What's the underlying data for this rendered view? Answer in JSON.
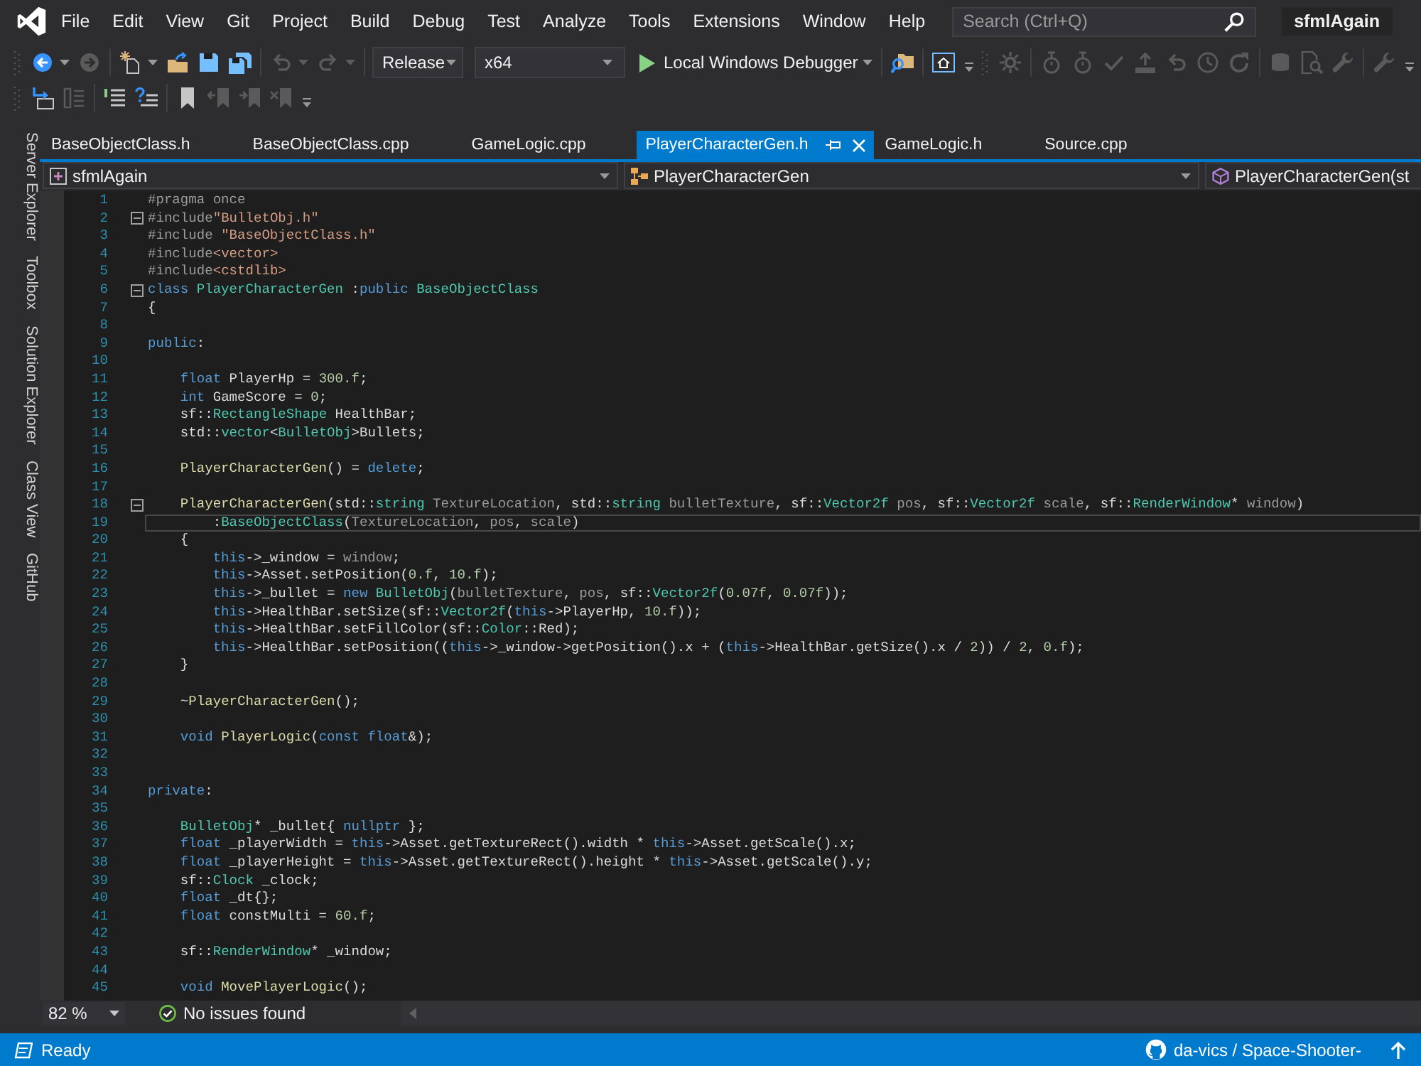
{
  "menu_bar": {
    "items": [
      "File",
      "Edit",
      "View",
      "Git",
      "Project",
      "Build",
      "Debug",
      "Test",
      "Analyze",
      "Tools",
      "Extensions",
      "Window",
      "Help"
    ],
    "search": {
      "placeholder": "Search (Ctrl+Q)"
    },
    "solution_name": "sfmlAgain"
  },
  "toolbar": {
    "rows": [
      [
        {
          "kind": "grip"
        },
        {
          "kind": "split",
          "disabled": false
        },
        {
          "kind": "button",
          "disabled": true
        },
        {
          "kind": "separator"
        },
        {
          "kind": "split",
          "disabled": false
        },
        {
          "kind": "button",
          "disabled": false
        },
        {
          "kind": "button",
          "disabled": false
        },
        {
          "kind": "button",
          "disabled": false
        },
        {
          "kind": "separator"
        },
        {
          "kind": "split",
          "disabled": true
        },
        {
          "kind": "split",
          "disabled": true
        },
        {
          "kind": "separator"
        },
        {
          "kind": "combo",
          "value": "Release"
        },
        {
          "kind": "combo",
          "value": "x64"
        },
        {
          "kind": "run",
          "label": "Local Windows Debugger"
        },
        {
          "kind": "separator"
        },
        {
          "kind": "button",
          "disabled": false
        },
        {
          "kind": "separator"
        },
        {
          "kind": "button",
          "disabled": false
        },
        {
          "kind": "overflow"
        },
        {
          "kind": "grip"
        },
        {
          "kind": "button",
          "disabled": true
        },
        {
          "kind": "separator"
        },
        {
          "kind": "button",
          "disabled": true
        },
        {
          "kind": "button",
          "disabled": true
        },
        {
          "kind": "button",
          "disabled": true
        },
        {
          "kind": "button",
          "disabled": true
        },
        {
          "kind": "button",
          "disabled": true
        },
        {
          "kind": "button",
          "disabled": true
        },
        {
          "kind": "button",
          "disabled": true
        },
        {
          "kind": "separator"
        },
        {
          "kind": "button",
          "disabled": true
        },
        {
          "kind": "button",
          "disabled": true
        },
        {
          "kind": "button",
          "disabled": true
        },
        {
          "kind": "separator"
        },
        {
          "kind": "button",
          "disabled": true
        },
        {
          "kind": "overflow"
        }
      ],
      [
        {
          "kind": "grip"
        },
        {
          "kind": "button",
          "disabled": false
        },
        {
          "kind": "button",
          "disabled": true
        },
        {
          "kind": "separator"
        },
        {
          "kind": "button",
          "disabled": false
        },
        {
          "kind": "button",
          "disabled": false
        },
        {
          "kind": "separator"
        },
        {
          "kind": "button",
          "disabled": false
        },
        {
          "kind": "button",
          "disabled": true
        },
        {
          "kind": "button",
          "disabled": true
        },
        {
          "kind": "button",
          "disabled": true
        },
        {
          "kind": "overflow"
        }
      ]
    ]
  },
  "tool_window_tabs": [
    "Server Explorer",
    "Toolbox",
    "Solution Explorer",
    "Class View",
    "GitHub"
  ],
  "document_tabs": [
    {
      "label": "BaseObjectClass.h",
      "selected": false
    },
    {
      "label": "BaseObjectClass.cpp",
      "selected": false
    },
    {
      "label": "GameLogic.cpp",
      "selected": false
    },
    {
      "label": "PlayerCharacterGen.h",
      "selected": true
    },
    {
      "label": "GameLogic.h",
      "selected": false
    },
    {
      "label": "Source.cpp",
      "selected": false
    }
  ],
  "navigation_bar": [
    {
      "kind": "project",
      "text": "sfmlAgain"
    },
    {
      "kind": "type",
      "text": "PlayerCharacterGen"
    },
    {
      "kind": "member",
      "text": "PlayerCharacterGen(st"
    }
  ],
  "editor": {
    "lines": [
      {
        "number": "1",
        "current": false,
        "tokens": [
          {
            "text": "#pragma once",
            "kind": "pre"
          }
        ]
      },
      {
        "number": "2",
        "current": false,
        "expanded": true,
        "tokens": [
          {
            "text": "#include",
            "kind": "pre"
          },
          {
            "text": "\"BulletObj.h\"",
            "kind": "str"
          }
        ]
      },
      {
        "number": "3",
        "current": false,
        "tokens": [
          {
            "text": "#include ",
            "kind": "pre"
          },
          {
            "text": "\"BaseObjectClass.h\"",
            "kind": "str"
          }
        ]
      },
      {
        "number": "4",
        "current": false,
        "tokens": [
          {
            "text": "#include",
            "kind": "pre"
          },
          {
            "text": "<vector>",
            "kind": "str"
          }
        ]
      },
      {
        "number": "5",
        "current": false,
        "tokens": [
          {
            "text": "#include",
            "kind": "pre"
          },
          {
            "text": "<cstdlib>",
            "kind": "str"
          }
        ]
      },
      {
        "number": "6",
        "current": false,
        "expanded": true,
        "tokens": [
          {
            "text": "class ",
            "kind": "kw"
          },
          {
            "text": "PlayerCharacterGen",
            "kind": "type"
          },
          {
            "text": " :",
            "kind": "plain"
          },
          {
            "text": "public ",
            "kind": "kw"
          },
          {
            "text": "BaseObjectClass",
            "kind": "type"
          }
        ]
      },
      {
        "number": "7",
        "current": false,
        "tokens": [
          {
            "text": "{",
            "kind": "plain"
          }
        ]
      },
      {
        "number": "8",
        "current": false
      },
      {
        "number": "9",
        "current": false,
        "tokens": [
          {
            "text": "public",
            "kind": "kw"
          },
          {
            "text": ":",
            "kind": "plain"
          }
        ]
      },
      {
        "number": "10",
        "current": false
      },
      {
        "number": "11",
        "current": false,
        "tokens": [
          {
            "text": "    float",
            "kind": "kw"
          },
          {
            "text": " PlayerHp = ",
            "kind": "plain"
          },
          {
            "text": "300.f",
            "kind": "num"
          },
          {
            "text": ";",
            "kind": "plain"
          }
        ]
      },
      {
        "number": "12",
        "current": false,
        "tokens": [
          {
            "text": "    int",
            "kind": "kw"
          },
          {
            "text": " GameScore = ",
            "kind": "plain"
          },
          {
            "text": "0",
            "kind": "num"
          },
          {
            "text": ";",
            "kind": "plain"
          }
        ]
      },
      {
        "number": "13",
        "current": false,
        "tokens": [
          {
            "text": "    sf::",
            "kind": "plain"
          },
          {
            "text": "RectangleShape",
            "kind": "type"
          },
          {
            "text": " HealthBar;",
            "kind": "plain"
          }
        ]
      },
      {
        "number": "14",
        "current": false,
        "tokens": [
          {
            "text": "    std::",
            "kind": "plain"
          },
          {
            "text": "vector",
            "kind": "type"
          },
          {
            "text": "<",
            "kind": "plain"
          },
          {
            "text": "BulletObj",
            "kind": "type"
          },
          {
            "text": ">Bullets;",
            "kind": "plain"
          }
        ]
      },
      {
        "number": "15",
        "current": false
      },
      {
        "number": "16",
        "current": false,
        "tokens": [
          {
            "text": "    PlayerCharacterGen",
            "kind": "fn"
          },
          {
            "text": "() = ",
            "kind": "plain"
          },
          {
            "text": "delete",
            "kind": "kw"
          },
          {
            "text": ";",
            "kind": "plain"
          }
        ]
      },
      {
        "number": "17",
        "current": false
      },
      {
        "number": "18",
        "current": false,
        "expanded": true,
        "tokens": [
          {
            "text": "    PlayerCharacterGen",
            "kind": "fn"
          },
          {
            "text": "(std::",
            "kind": "plain"
          },
          {
            "text": "string ",
            "kind": "type"
          },
          {
            "text": "TextureLocation",
            "kind": "param"
          },
          {
            "text": ", std::",
            "kind": "plain"
          },
          {
            "text": "string ",
            "kind": "type"
          },
          {
            "text": "bulletTexture",
            "kind": "param"
          },
          {
            "text": ", sf::",
            "kind": "plain"
          },
          {
            "text": "Vector2f ",
            "kind": "type"
          },
          {
            "text": "pos",
            "kind": "param"
          },
          {
            "text": ", sf::",
            "kind": "plain"
          },
          {
            "text": "Vector2f ",
            "kind": "type"
          },
          {
            "text": "scale",
            "kind": "param"
          },
          {
            "text": ", sf::",
            "kind": "plain"
          },
          {
            "text": "RenderWindow",
            "kind": "type"
          },
          {
            "text": "* ",
            "kind": "plain"
          },
          {
            "text": "window",
            "kind": "param"
          },
          {
            "text": ")",
            "kind": "plain"
          }
        ]
      },
      {
        "number": "19",
        "current": true,
        "tokens": [
          {
            "text": "        :",
            "kind": "plain"
          },
          {
            "text": "BaseObjectClass",
            "kind": "type"
          },
          {
            "text": "(",
            "kind": "plain"
          },
          {
            "text": "TextureLocation",
            "kind": "param"
          },
          {
            "text": ", ",
            "kind": "plain"
          },
          {
            "text": "pos",
            "kind": "param"
          },
          {
            "text": ", ",
            "kind": "plain"
          },
          {
            "text": "scale",
            "kind": "param"
          },
          {
            "text": ")",
            "kind": "plain"
          }
        ]
      },
      {
        "number": "20",
        "current": false,
        "tokens": [
          {
            "text": "    {",
            "kind": "plain"
          }
        ]
      },
      {
        "number": "21",
        "current": false,
        "tokens": [
          {
            "text": "        this",
            "kind": "kw"
          },
          {
            "text": "->_window = ",
            "kind": "plain"
          },
          {
            "text": "window",
            "kind": "param"
          },
          {
            "text": ";",
            "kind": "plain"
          }
        ]
      },
      {
        "number": "22",
        "current": false,
        "tokens": [
          {
            "text": "        this",
            "kind": "kw"
          },
          {
            "text": "->Asset.setPosition(",
            "kind": "plain"
          },
          {
            "text": "0.f",
            "kind": "num"
          },
          {
            "text": ", ",
            "kind": "plain"
          },
          {
            "text": "10.f",
            "kind": "num"
          },
          {
            "text": ");",
            "kind": "plain"
          }
        ]
      },
      {
        "number": "23",
        "current": false,
        "tokens": [
          {
            "text": "        this",
            "kind": "kw"
          },
          {
            "text": "->_bullet = ",
            "kind": "plain"
          },
          {
            "text": "new ",
            "kind": "kw"
          },
          {
            "text": "BulletObj",
            "kind": "type"
          },
          {
            "text": "(",
            "kind": "plain"
          },
          {
            "text": "bulletTexture",
            "kind": "param"
          },
          {
            "text": ", ",
            "kind": "plain"
          },
          {
            "text": "pos",
            "kind": "param"
          },
          {
            "text": ", sf::",
            "kind": "plain"
          },
          {
            "text": "Vector2f",
            "kind": "type"
          },
          {
            "text": "(",
            "kind": "plain"
          },
          {
            "text": "0.07f",
            "kind": "num"
          },
          {
            "text": ", ",
            "kind": "plain"
          },
          {
            "text": "0.07f",
            "kind": "num"
          },
          {
            "text": "));",
            "kind": "plain"
          }
        ]
      },
      {
        "number": "24",
        "current": false,
        "tokens": [
          {
            "text": "        this",
            "kind": "kw"
          },
          {
            "text": "->HealthBar.setSize(sf::",
            "kind": "plain"
          },
          {
            "text": "Vector2f",
            "kind": "type"
          },
          {
            "text": "(",
            "kind": "plain"
          },
          {
            "text": "this",
            "kind": "kw"
          },
          {
            "text": "->PlayerHp, ",
            "kind": "plain"
          },
          {
            "text": "10.f",
            "kind": "num"
          },
          {
            "text": "));",
            "kind": "plain"
          }
        ]
      },
      {
        "number": "25",
        "current": false,
        "tokens": [
          {
            "text": "        this",
            "kind": "kw"
          },
          {
            "text": "->HealthBar.setFillColor(sf::",
            "kind": "plain"
          },
          {
            "text": "Color",
            "kind": "type"
          },
          {
            "text": "::Red);",
            "kind": "plain"
          }
        ]
      },
      {
        "number": "26",
        "current": false,
        "tokens": [
          {
            "text": "        this",
            "kind": "kw"
          },
          {
            "text": "->HealthBar.setPosition((",
            "kind": "plain"
          },
          {
            "text": "this",
            "kind": "kw"
          },
          {
            "text": "->_window->getPosition().x + (",
            "kind": "plain"
          },
          {
            "text": "this",
            "kind": "kw"
          },
          {
            "text": "->HealthBar.getSize().x / ",
            "kind": "plain"
          },
          {
            "text": "2",
            "kind": "num"
          },
          {
            "text": ")) / ",
            "kind": "plain"
          },
          {
            "text": "2",
            "kind": "num"
          },
          {
            "text": ", ",
            "kind": "plain"
          },
          {
            "text": "0.f",
            "kind": "num"
          },
          {
            "text": ");",
            "kind": "plain"
          }
        ]
      },
      {
        "number": "27",
        "current": false,
        "tokens": [
          {
            "text": "    }",
            "kind": "plain"
          }
        ]
      },
      {
        "number": "28",
        "current": false
      },
      {
        "number": "29",
        "current": false,
        "tokens": [
          {
            "text": "    ~",
            "kind": "plain"
          },
          {
            "text": "PlayerCharacterGen",
            "kind": "fn"
          },
          {
            "text": "();",
            "kind": "plain"
          }
        ]
      },
      {
        "number": "30",
        "current": false
      },
      {
        "number": "31",
        "current": false,
        "tokens": [
          {
            "text": "    void ",
            "kind": "kw"
          },
          {
            "text": "PlayerLogic",
            "kind": "fn"
          },
          {
            "text": "(",
            "kind": "plain"
          },
          {
            "text": "const float",
            "kind": "kw"
          },
          {
            "text": "&);",
            "kind": "plain"
          }
        ]
      },
      {
        "number": "32",
        "current": false
      },
      {
        "number": "33",
        "current": false
      },
      {
        "number": "34",
        "current": false,
        "tokens": [
          {
            "text": "private",
            "kind": "kw"
          },
          {
            "text": ":",
            "kind": "plain"
          }
        ]
      },
      {
        "number": "35",
        "current": false
      },
      {
        "number": "36",
        "current": false,
        "tokens": [
          {
            "text": "    BulletObj",
            "kind": "type"
          },
          {
            "text": "* _bullet{ ",
            "kind": "plain"
          },
          {
            "text": "nullptr",
            "kind": "kw"
          },
          {
            "text": " };",
            "kind": "plain"
          }
        ]
      },
      {
        "number": "37",
        "current": false,
        "tokens": [
          {
            "text": "    float",
            "kind": "kw"
          },
          {
            "text": " _playerWidth = ",
            "kind": "plain"
          },
          {
            "text": "this",
            "kind": "kw"
          },
          {
            "text": "->Asset.getTextureRect().width * ",
            "kind": "plain"
          },
          {
            "text": "this",
            "kind": "kw"
          },
          {
            "text": "->Asset.getScale().x;",
            "kind": "plain"
          }
        ]
      },
      {
        "number": "38",
        "current": false,
        "tokens": [
          {
            "text": "    float",
            "kind": "kw"
          },
          {
            "text": " _playerHeight = ",
            "kind": "plain"
          },
          {
            "text": "this",
            "kind": "kw"
          },
          {
            "text": "->Asset.getTextureRect().height * ",
            "kind": "plain"
          },
          {
            "text": "this",
            "kind": "kw"
          },
          {
            "text": "->Asset.getScale().y;",
            "kind": "plain"
          }
        ]
      },
      {
        "number": "39",
        "current": false,
        "tokens": [
          {
            "text": "    sf::",
            "kind": "plain"
          },
          {
            "text": "Clock",
            "kind": "type"
          },
          {
            "text": " _clock;",
            "kind": "plain"
          }
        ]
      },
      {
        "number": "40",
        "current": false,
        "tokens": [
          {
            "text": "    float",
            "kind": "kw"
          },
          {
            "text": " _dt{};",
            "kind": "plain"
          }
        ]
      },
      {
        "number": "41",
        "current": false,
        "tokens": [
          {
            "text": "    float",
            "kind": "kw"
          },
          {
            "text": " constMulti = ",
            "kind": "plain"
          },
          {
            "text": "60.f",
            "kind": "num"
          },
          {
            "text": ";",
            "kind": "plain"
          }
        ]
      },
      {
        "number": "42",
        "current": false
      },
      {
        "number": "43",
        "current": false,
        "tokens": [
          {
            "text": "    sf::",
            "kind": "plain"
          },
          {
            "text": "RenderWindow",
            "kind": "type"
          },
          {
            "text": "* _window;",
            "kind": "plain"
          }
        ]
      },
      {
        "number": "44",
        "current": false
      },
      {
        "number": "45",
        "current": false,
        "tokens": [
          {
            "text": "    void ",
            "kind": "kw"
          },
          {
            "text": "MovePlayerLogic",
            "kind": "fn"
          },
          {
            "text": "();",
            "kind": "plain"
          }
        ]
      }
    ]
  },
  "editor_footer": {
    "zoom": "82 %",
    "issues": "No issues found"
  },
  "status_bar": {
    "text": "Ready",
    "repository": "da-vics / Space-Shooter-"
  }
}
